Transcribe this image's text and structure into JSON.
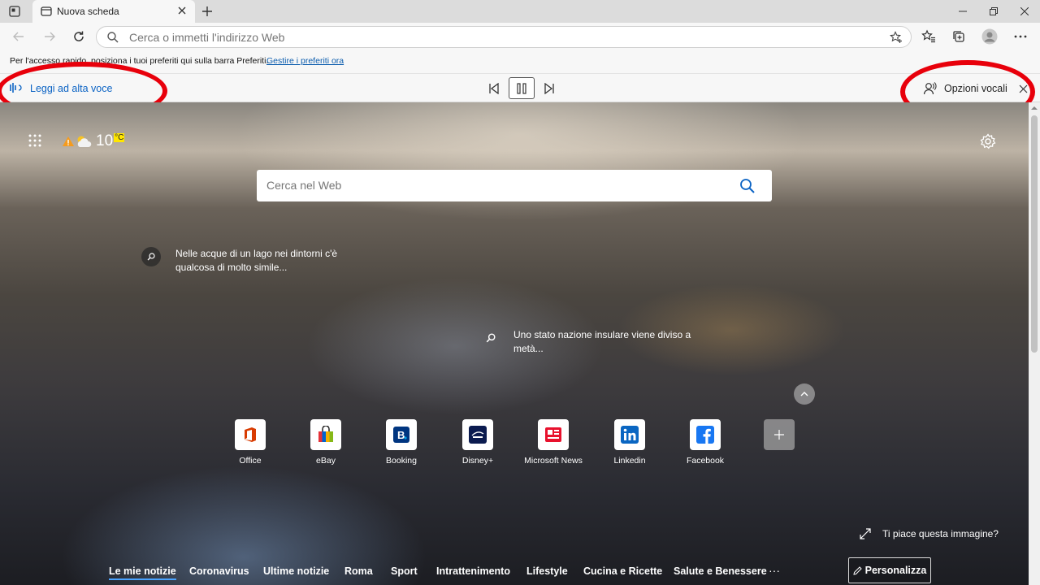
{
  "browser": {
    "tab": {
      "title": "Nuova scheda"
    },
    "address_bar": {
      "placeholder": "Cerca o immetti l'indirizzo Web"
    },
    "favorites_bar": {
      "message": "Per l'accesso rapido, posiziona i tuoi preferiti qui sulla barra Preferiti.",
      "manage_link": "Gestire i preferiti ora"
    }
  },
  "read_aloud": {
    "label": "Leggi ad alta voce",
    "voice_options_label": "Opzioni vocali"
  },
  "new_tab_page": {
    "weather": {
      "temperature": "10",
      "unit": "°C"
    },
    "search": {
      "placeholder": "Cerca nel Web"
    },
    "hotspots": [
      {
        "text": "Nelle acque di un lago nei dintorni c'è qualcosa di molto simile..."
      },
      {
        "text": "Uno stato nazione insulare viene diviso a metà..."
      }
    ],
    "quick_links": [
      {
        "label": "Office",
        "color": "#d83b01"
      },
      {
        "label": "eBay",
        "color": "#e53238"
      },
      {
        "label": "Booking",
        "color": "#003580"
      },
      {
        "label": "Disney+",
        "color": "#0b1b4f"
      },
      {
        "label": "Microsoft News",
        "color": "#e8112d"
      },
      {
        "label": "Linkedin",
        "color": "#0a66c2"
      },
      {
        "label": "Facebook",
        "color": "#1877f2"
      }
    ],
    "image_feedback": "Ti piace questa immagine?",
    "news_tabs": [
      "Le mie notizie",
      "Coronavirus",
      "Ultime notizie",
      "Roma",
      "Sport",
      "Intrattenimento",
      "Lifestyle",
      "Cucina e Ricette",
      "Salute e Benessere"
    ],
    "more": "···",
    "personalize_label": "Personalizza"
  },
  "colors": {
    "accent": "#0b63c4",
    "annotation": "#e8000b"
  }
}
